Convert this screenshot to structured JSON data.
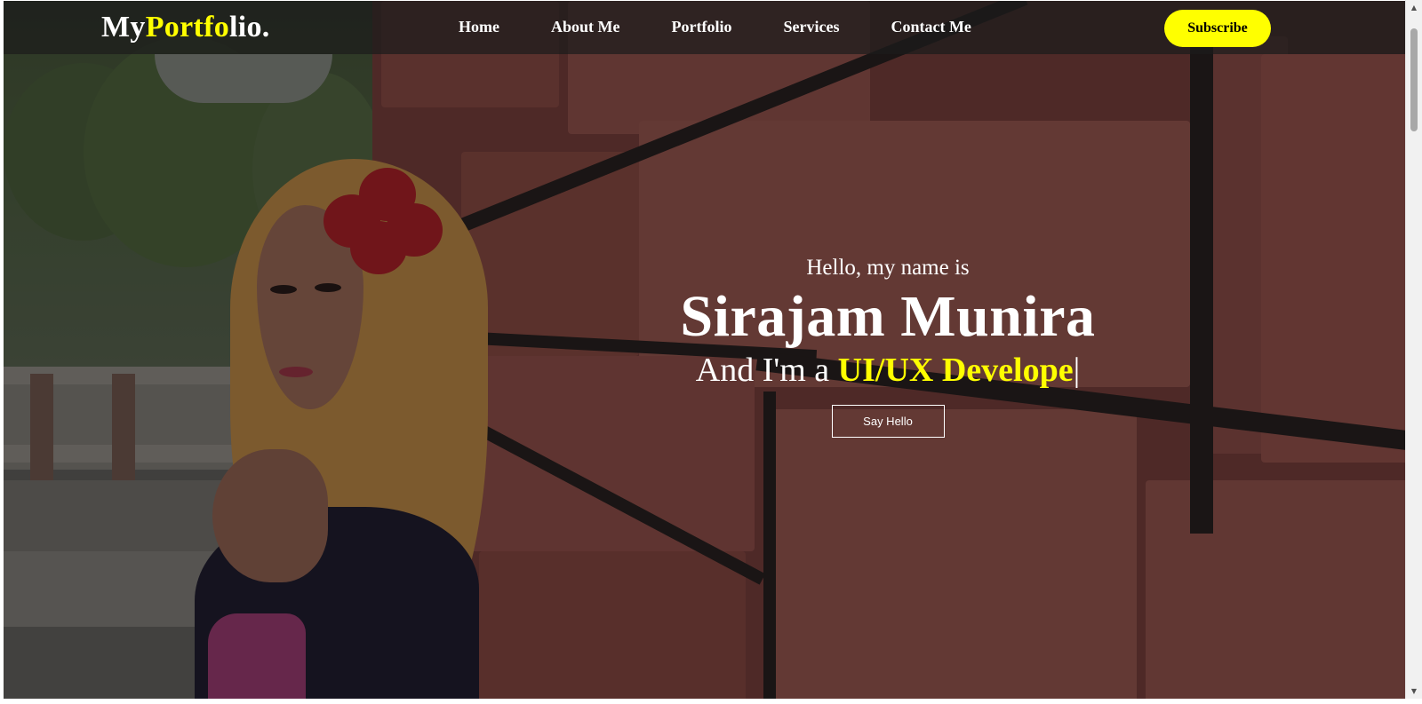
{
  "logo": {
    "part1": "My",
    "part2": "Portfo",
    "part3": "lio."
  },
  "nav": {
    "items": [
      {
        "label": "Home"
      },
      {
        "label": "About Me"
      },
      {
        "label": "Portfolio"
      },
      {
        "label": "Services"
      },
      {
        "label": "Contact Me"
      }
    ],
    "subscribe_label": "Subscribe"
  },
  "hero": {
    "greeting": "Hello, my name is",
    "name": "Sirajam Munira",
    "role_prefix": "And I'm a ",
    "role_typed": "UI/UX Develope",
    "cursor": "|",
    "cta_label": "Say Hello"
  },
  "scrollbar": {
    "up_icon": "▲",
    "down_icon": "▼"
  },
  "colors": {
    "accent": "#ffff00",
    "navbar_bg": "rgba(28,28,28,0.72)",
    "text": "#ffffff"
  },
  "icons": {
    "scroll_up": "scroll-up-arrow-icon",
    "scroll_down": "scroll-down-arrow-icon"
  }
}
